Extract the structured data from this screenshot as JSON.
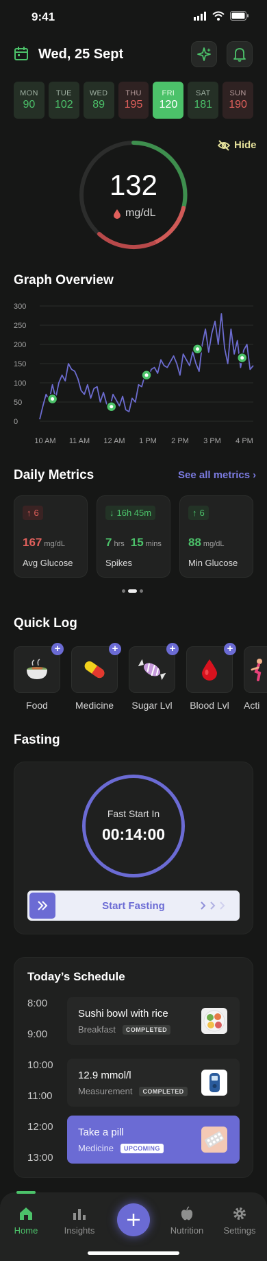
{
  "status": {
    "time": "9:41"
  },
  "header": {
    "date": "Wed, 25 Sept"
  },
  "days": [
    {
      "name": "MON",
      "value": "90",
      "state": "good"
    },
    {
      "name": "TUE",
      "value": "102",
      "state": "good"
    },
    {
      "name": "WED",
      "value": "89",
      "state": "good"
    },
    {
      "name": "THU",
      "value": "195",
      "state": "bad"
    },
    {
      "name": "FRI",
      "value": "120",
      "state": "active"
    },
    {
      "name": "SAT",
      "value": "181",
      "state": "good"
    },
    {
      "name": "SUN",
      "value": "190",
      "state": "bad"
    }
  ],
  "gauge": {
    "value": "132",
    "unit": "mg/dL",
    "hide_label": "Hide"
  },
  "graph": {
    "title": "Graph Overview",
    "y_ticks": [
      "300",
      "250",
      "200",
      "150",
      "100",
      "50",
      "0"
    ],
    "x_ticks": [
      "10 AM",
      "11 AM",
      "12 AM",
      "1 PM",
      "2 PM",
      "3 PM",
      "4 PM"
    ]
  },
  "chart_data": {
    "type": "line",
    "ylim": [
      0,
      300
    ],
    "x": [
      0,
      0.1,
      0.2,
      0.3,
      0.4,
      0.5,
      0.6,
      0.7,
      0.8,
      0.9,
      1.0,
      1.1,
      1.2,
      1.3,
      1.4,
      1.5,
      1.6,
      1.7,
      1.8,
      1.9,
      2.0,
      2.1,
      2.2,
      2.3,
      2.4,
      2.5,
      2.6,
      2.7,
      2.8,
      2.9,
      3.0,
      3.1,
      3.2,
      3.3,
      3.4,
      3.5,
      3.6,
      3.7,
      3.8,
      3.9,
      4.0,
      4.1,
      4.2,
      4.3,
      4.4,
      4.5,
      4.6,
      4.7,
      4.8,
      4.9,
      5.0,
      5.1,
      5.2,
      5.3,
      5.4,
      5.5,
      5.6,
      5.7,
      5.8,
      5.9,
      6.0,
      6.1,
      6.2,
      6.3,
      6.4,
      6.5,
      6.6,
      6.7
    ],
    "series": [
      {
        "values": [
          5,
          40,
          70,
          55,
          95,
          60,
          100,
          120,
          105,
          150,
          135,
          130,
          110,
          80,
          70,
          95,
          60,
          85,
          90,
          50,
          75,
          45,
          35,
          70,
          55,
          40,
          65,
          30,
          25,
          60,
          50,
          95,
          90,
          120,
          110,
          135,
          140,
          125,
          160,
          145,
          140,
          155,
          170,
          150,
          120,
          175,
          160,
          145,
          180,
          150,
          130,
          200,
          240,
          180,
          230,
          260,
          200,
          280,
          190,
          150,
          240,
          175,
          210,
          140,
          185,
          200,
          135,
          145
        ]
      }
    ],
    "markers": [
      {
        "x": 0.4,
        "y": 58,
        "icon": "food"
      },
      {
        "x": 2.25,
        "y": 38,
        "icon": "medicine"
      },
      {
        "x": 3.35,
        "y": 120,
        "icon": "fasting"
      },
      {
        "x": 4.95,
        "y": 188,
        "icon": "food"
      },
      {
        "x": 6.35,
        "y": 165,
        "icon": "medicine"
      }
    ]
  },
  "metrics": {
    "title": "Daily Metrics",
    "see_all": "See all metrics",
    "cards": [
      {
        "badge": "6",
        "arrow": "↑",
        "value": "167",
        "unit": "mg/dL",
        "label": "Avg Glucose",
        "tone": "red"
      },
      {
        "badge": "16h 45m",
        "arrow": "↓",
        "value_a": "7",
        "unit_a": "hrs",
        "value_b": "15",
        "unit_b": "mins",
        "label": "Spikes",
        "tone": "green"
      },
      {
        "badge": "6",
        "arrow": "↑",
        "value": "88",
        "unit": "mg/dL",
        "label": "Min Glucose",
        "tone": "green"
      }
    ]
  },
  "quick_log": {
    "title": "Quick Log",
    "items": [
      {
        "label": "Food",
        "icon": "food-bowl-icon"
      },
      {
        "label": "Medicine",
        "icon": "pill-capsule-icon"
      },
      {
        "label": "Sugar Lvl",
        "icon": "candy-icon"
      },
      {
        "label": "Blood Lvl",
        "icon": "blood-drop-icon"
      },
      {
        "label": "Acti",
        "icon": "running-icon"
      }
    ]
  },
  "fasting": {
    "title": "Fasting",
    "caption": "Fast Start In",
    "timer": "00:14:00",
    "button": "Start Fasting"
  },
  "schedule": {
    "title": "Today’s Schedule",
    "times": [
      "8:00",
      "9:00",
      "10:00",
      "11:00",
      "12:00",
      "13:00"
    ],
    "items": [
      {
        "title": "Sushi bowl with rice",
        "subtitle": "Breakfast",
        "status": "COMPLETED",
        "thumb": "sushi-bowl-icon"
      },
      {
        "title": "12.9 mmol/l",
        "subtitle": "Measurement",
        "status": "COMPLETED",
        "thumb": "glucometer-icon"
      },
      {
        "title": "Take a pill",
        "subtitle": "Medicine",
        "status": "UPCOMING",
        "thumb": "pill-pack-icon"
      }
    ]
  },
  "tabs": [
    {
      "label": "Home",
      "icon": "home-icon",
      "active": true
    },
    {
      "label": "Insights",
      "icon": "bar-chart-icon"
    },
    {
      "label": "",
      "icon": "plus-icon"
    },
    {
      "label": "Nutrition",
      "icon": "apple-icon"
    },
    {
      "label": "Settings",
      "icon": "gear-icon"
    }
  ],
  "colors": {
    "accent": "#4cc26a",
    "danger": "#e0605c",
    "purple": "#6b6bd4",
    "line": "#6c6ccf"
  }
}
